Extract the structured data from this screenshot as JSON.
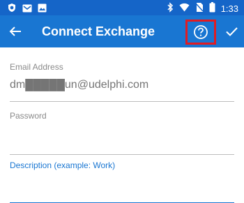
{
  "status_bar": {
    "time": "1:33",
    "left_icons": [
      "shield-icon",
      "mail-icon",
      "image-icon"
    ],
    "right_icons": [
      "bluetooth-icon",
      "wifi-icon",
      "no-sim-icon",
      "battery-icon"
    ]
  },
  "app_bar": {
    "title": "Connect Exchange",
    "back_icon": "arrow-left-icon",
    "help_icon": "help-circle-icon",
    "done_icon": "checkmark-icon",
    "highlight_color": "#e11b22"
  },
  "form": {
    "email": {
      "label": "Email Address",
      "value": "dm█████un@udelphi.com"
    },
    "password": {
      "label": "Password",
      "value": ""
    },
    "description": {
      "label": "Description (example: Work)",
      "value": ""
    }
  },
  "colors": {
    "status_bar": "#1565c8",
    "app_bar": "#1976d2",
    "accent": "#1976d2",
    "label": "#8a8a8a",
    "divider": "#bdbdbd"
  }
}
